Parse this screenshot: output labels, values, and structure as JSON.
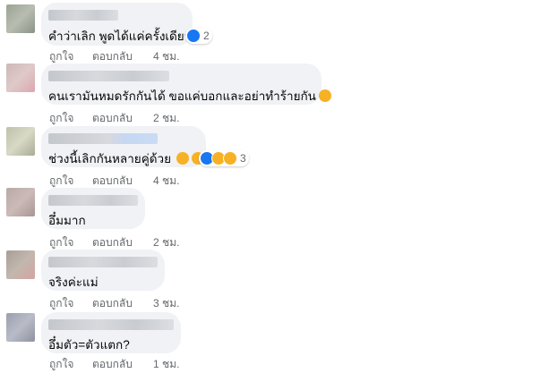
{
  "comments": [
    {
      "text": "คำว่าเลิก พูดได้แค่ครั้งเดียว",
      "reaction_count": "2",
      "like_label": "ถูกใจ",
      "reply_label": "ตอบกลับ",
      "time": "4 ชม.",
      "reactions": [
        "like-icon"
      ]
    },
    {
      "text": "คนเรามันหมดรักกันได้ ขอแค่บอกและอย่าทำร้ายกัน",
      "like_label": "ถูกใจ",
      "reply_label": "ตอบกลับ",
      "time": "2 ชม.",
      "inline_emoji": "sad-face-icon"
    },
    {
      "text": "ช่วงนี้เลิกกันหลายคู่ด้วย",
      "reaction_count": "3",
      "like_label": "ถูกใจ",
      "reply_label": "ตอบกลับ",
      "time": "4 ชม.",
      "reactions": [
        "like-icon",
        "haha-icon",
        "wow-icon"
      ],
      "inline_emoji": "crying-and-grinning-emoji"
    },
    {
      "text": "อึ๋มมาก",
      "like_label": "ถูกใจ",
      "reply_label": "ตอบกลับ",
      "time": "2 ชม."
    },
    {
      "text": "จริงค่ะแม่",
      "like_label": "ถูกใจ",
      "reply_label": "ตอบกลับ",
      "time": "3 ชม."
    },
    {
      "text": "อึ๋มตัว=ตัวแตก?",
      "like_label": "ถูกใจ",
      "reply_label": "ตอบกลับ",
      "time": "1 ชม."
    }
  ],
  "colors": {
    "bubble": "#f0f2f5",
    "meta_text": "#65676b",
    "like_blue": "#1877f2",
    "emoji_yellow": "#f7b125"
  }
}
